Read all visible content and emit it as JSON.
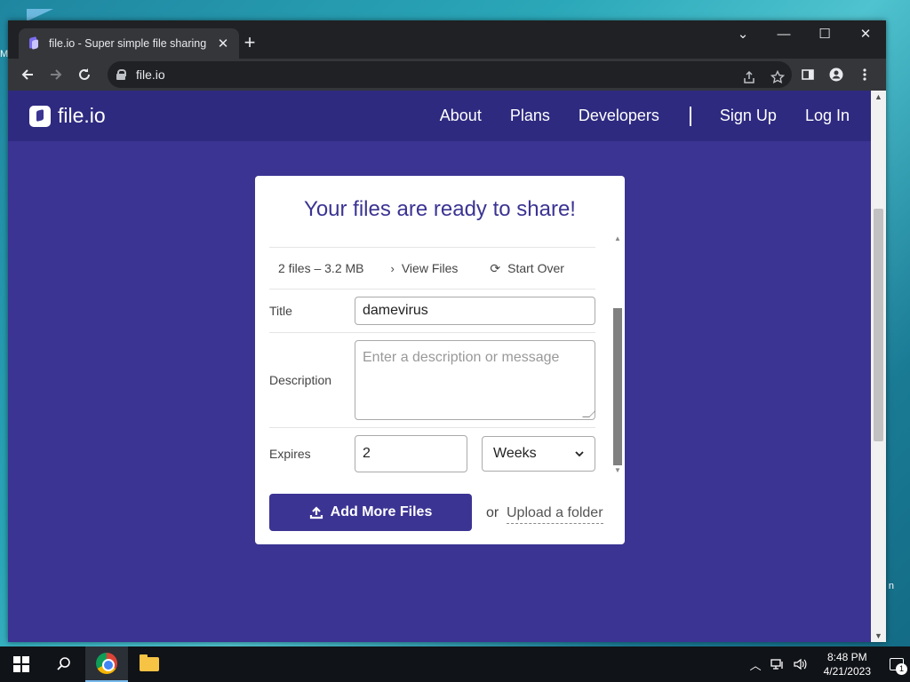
{
  "desktop": {
    "left_fragment": "M",
    "right_fragment": "n"
  },
  "browser": {
    "tab_title": "file.io - Super simple file sharing",
    "tab_close": "✕",
    "new_tab": "+",
    "url": "file.io",
    "window_controls": {
      "dropdown": "⌄",
      "minimize": "—",
      "maximize": "☐",
      "close": "✕"
    }
  },
  "site": {
    "logo_text": "file.io",
    "nav": {
      "about": "About",
      "plans": "Plans",
      "developers": "Developers",
      "signup": "Sign Up",
      "login": "Log In"
    }
  },
  "card": {
    "title": "Your files are ready to share!",
    "summary": "2 files – 3.2 MB",
    "view_files": "View Files",
    "start_over": "Start Over",
    "title_label": "Title",
    "title_value": "damevirus",
    "description_label": "Description",
    "description_placeholder": "Enter a description or message",
    "expires_label": "Expires",
    "expires_value": "2",
    "expires_unit": "Weeks",
    "add_files": "Add More Files",
    "or_text": "or",
    "upload_folder": "Upload a folder"
  },
  "taskbar": {
    "time": "8:48 PM",
    "date": "4/21/2023",
    "notifications": "1"
  },
  "colors": {
    "brand": "#3b3493",
    "header": "#2e2a80",
    "chrome_dark": "#202124"
  }
}
